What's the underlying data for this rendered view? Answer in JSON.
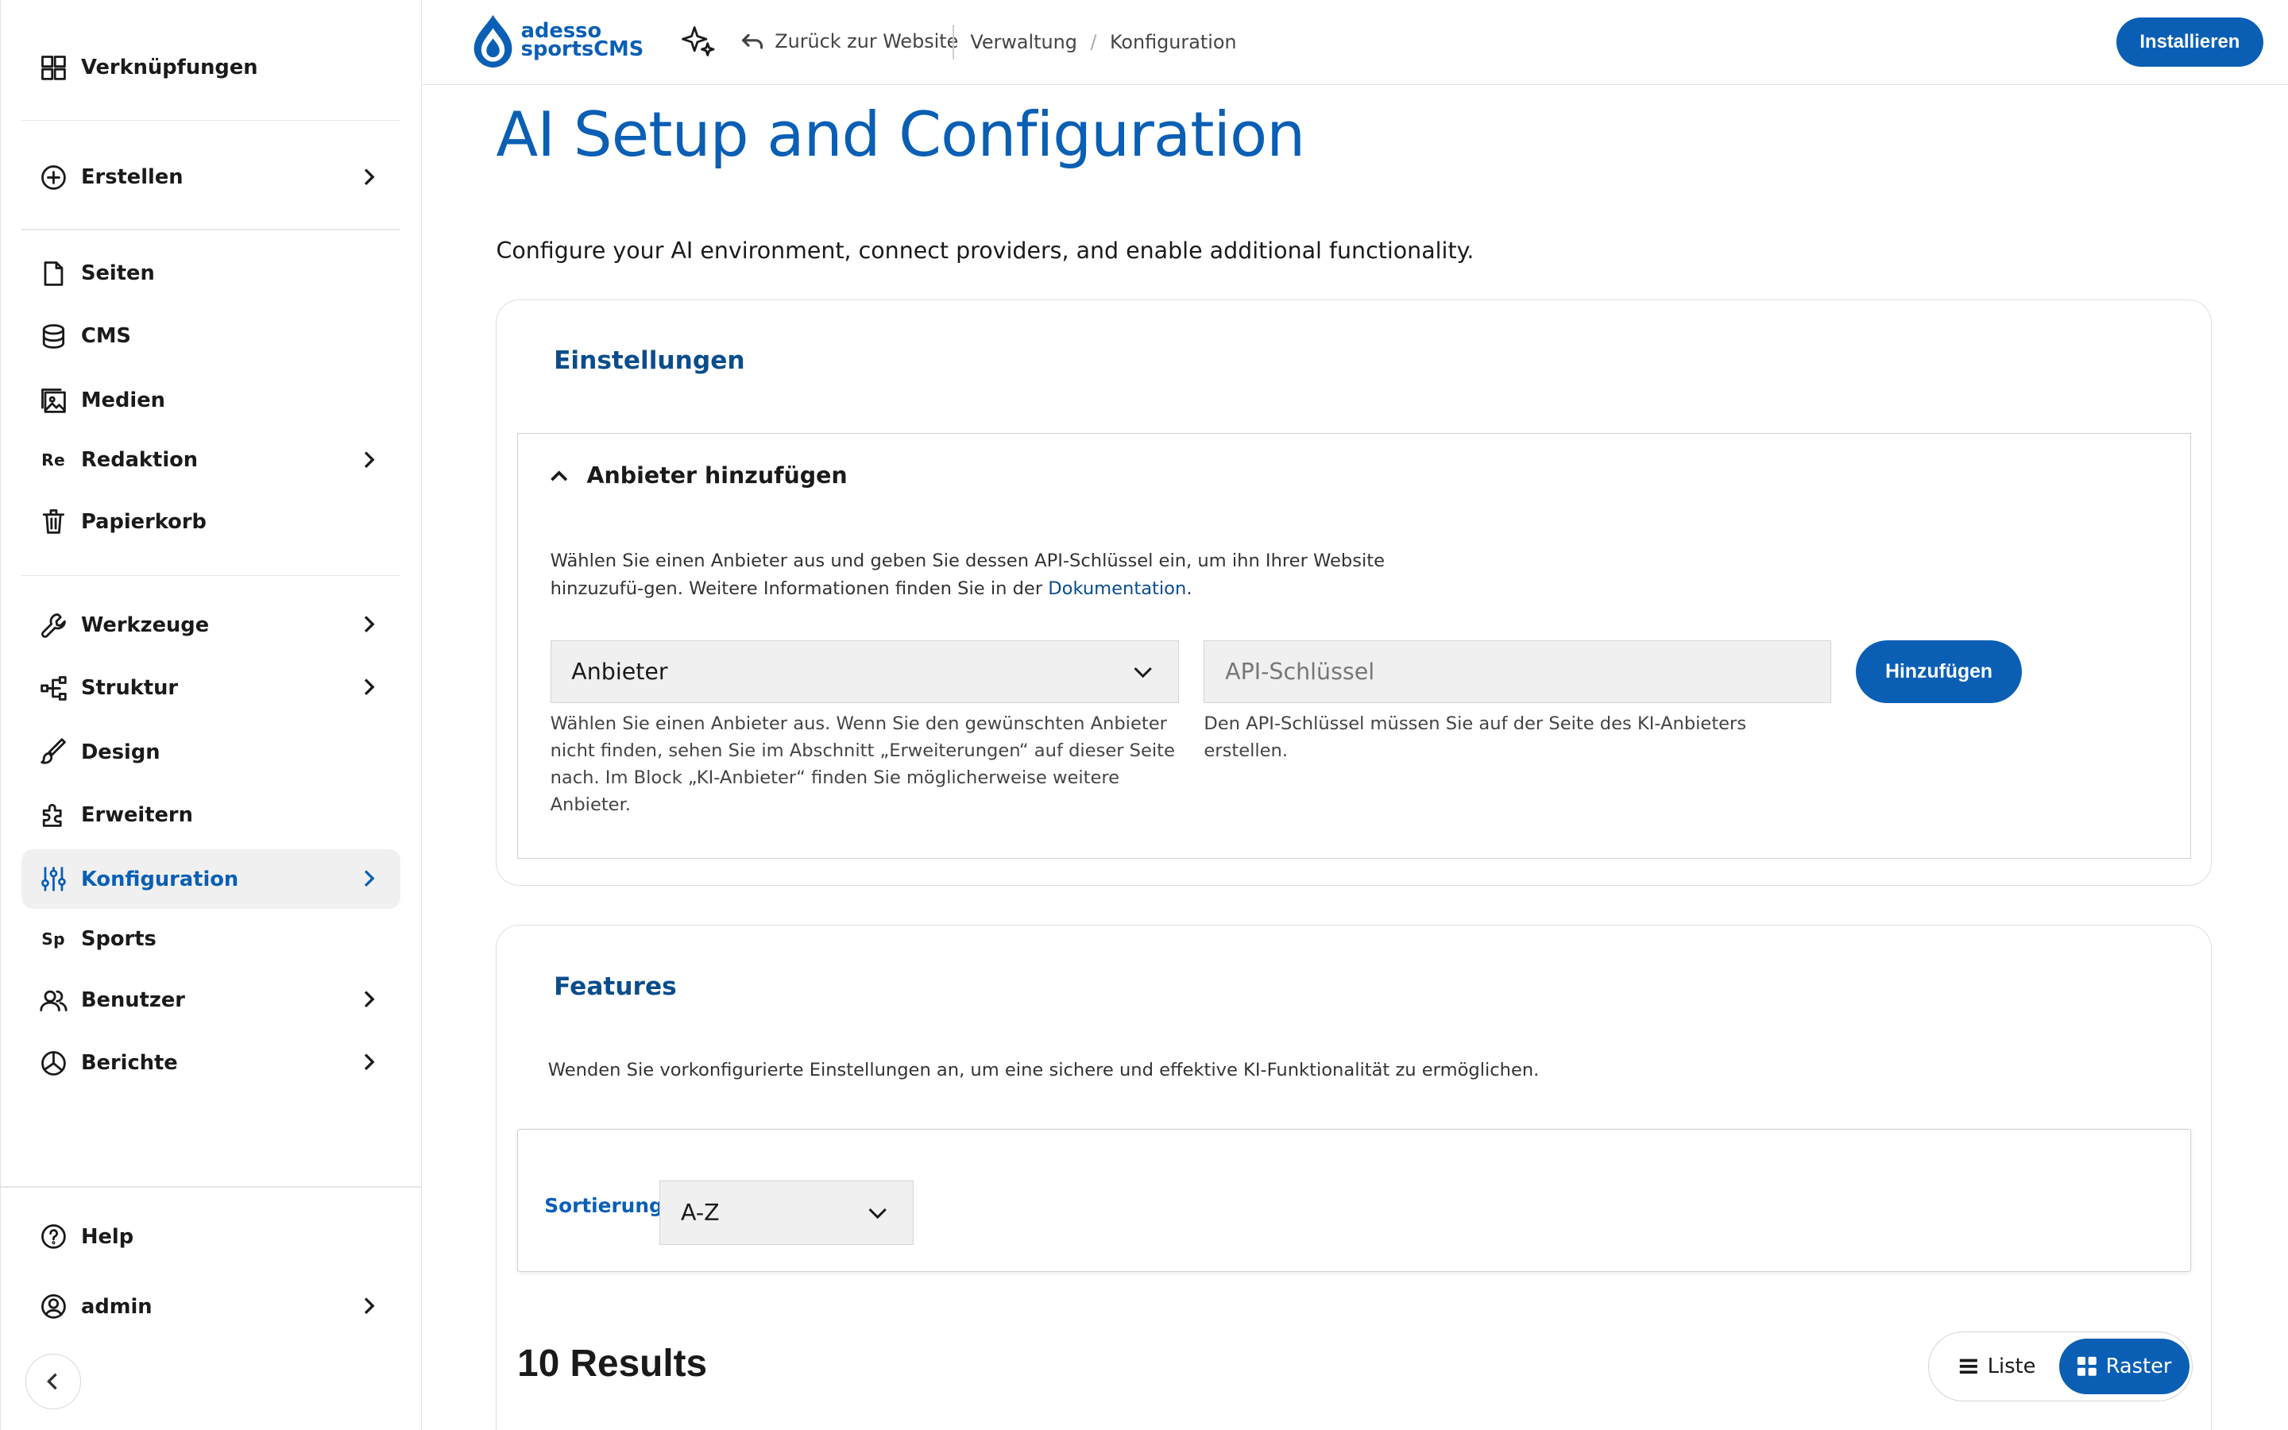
{
  "brand": {
    "line1": "adesso",
    "line2": "sportsCMS",
    "color": "#0a5fb5"
  },
  "topbar": {
    "back_label": "Zurück zur Website",
    "breadcrumbs": [
      "Verwaltung",
      "Konfiguration"
    ],
    "install_label": "Installieren"
  },
  "sidebar": {
    "items": [
      {
        "label": "Verknüpfungen",
        "icon": "shortcuts-icon"
      },
      {
        "label": "Erstellen",
        "icon": "plus-circle-icon"
      },
      {
        "label": "Seiten",
        "icon": "page-icon"
      },
      {
        "label": "CMS",
        "icon": "database-icon"
      },
      {
        "label": "Medien",
        "icon": "media-icon"
      },
      {
        "label": "Redaktion",
        "icon_text": "Re"
      },
      {
        "label": "Papierkorb",
        "icon": "trash-icon"
      },
      {
        "label": "Werkzeuge",
        "icon": "wrench-icon"
      },
      {
        "label": "Struktur",
        "icon": "structure-icon"
      },
      {
        "label": "Design",
        "icon": "brush-icon"
      },
      {
        "label": "Erweitern",
        "icon": "puzzle-icon"
      },
      {
        "label": "Konfiguration",
        "icon": "sliders-icon",
        "active": true
      },
      {
        "label": "Sports",
        "icon_text": "Sp"
      },
      {
        "label": "Benutzer",
        "icon": "users-icon"
      },
      {
        "label": "Berichte",
        "icon": "chart-pie-icon"
      },
      {
        "label": "Help",
        "icon": "help-circle-icon"
      },
      {
        "label": "admin",
        "icon": "user-circle-icon"
      }
    ]
  },
  "page": {
    "title": "AI Setup and Configuration",
    "subtitle": "Configure your AI environment, connect providers, and enable additional functionality."
  },
  "settings": {
    "title": "Einstellungen",
    "section_title": "Anbieter hinzufügen",
    "description_before": "Wählen Sie einen Anbieter aus und geben Sie dessen API-Schlüssel ein, um ihn Ihrer Website hinzuzufü-gen. Weitere Informationen finden Sie in der ",
    "description_link": "Dokumentation",
    "description_after": ".",
    "provider_select_value": "Anbieter",
    "provider_help": "Wählen Sie einen Anbieter aus. Wenn Sie den gewünschten Anbieter nicht finden, sehen Sie im Abschnitt „Erweiterungen“ auf dieser Seite nach. Im Block „KI-Anbieter“ finden Sie möglicherweise weitere Anbieter.",
    "api_key_placeholder": "API-Schlüssel",
    "api_key_value": "",
    "api_key_help": "Den API-Schlüssel müssen Sie auf der Seite des KI-Anbieters erstellen.",
    "add_label": "Hinzufügen"
  },
  "features": {
    "title": "Features",
    "description": "Wenden Sie vorkonfigurierte Einstellungen an, um eine sichere und effektive KI-Funktionalität zu ermöglichen.",
    "sort_label": "Sortierung",
    "sort_value": "A-Z",
    "results": "10 Results",
    "view_list": "Liste",
    "view_grid": "Raster",
    "view_selected": "Raster"
  }
}
